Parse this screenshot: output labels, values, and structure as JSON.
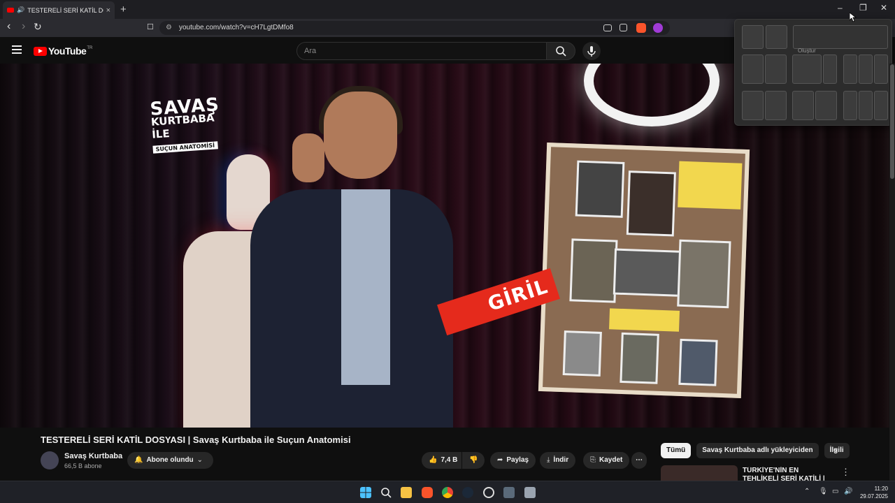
{
  "browser": {
    "tab_title": "TESTERELİ SERİ KATİL DOSYASI",
    "url": "youtube.com/watch?v=cH7LgtDMfo8",
    "new_tab": "+",
    "tab_close": "×",
    "minimize": "–",
    "restore": "❐",
    "close": "✕",
    "back": "‹",
    "forward": "›",
    "reload": "↻",
    "bookmark": "🔖"
  },
  "snap_menu": {
    "create_label": "Oluştur"
  },
  "youtube": {
    "logo_text": "YouTube",
    "country_code": "TR",
    "search_placeholder": "Ara"
  },
  "video": {
    "overlay_logo_line1": "SAVAŞ",
    "overlay_logo_line2": "KURTBABA İLE",
    "overlay_logo_line3": "SUÇUN ANATOMİSİ",
    "tape_text": "GİRİL"
  },
  "watch": {
    "title": "TESTERELİ SERİ KATİL DOSYASI | Savaş Kurtbaba ile Suçun Anatomisi",
    "channel_name": "Savaş Kurtbaba",
    "subscribers": "66,5 B abone",
    "subscribe_label": "Abone olundu",
    "likes": "7,4 B",
    "share_label": "Paylaş",
    "download_label": "İndir",
    "save_label": "Kaydet",
    "more_label": "⋯"
  },
  "related": {
    "chips": [
      "Tümü",
      "Savaş Kurtbaba adlı yükleyiciden",
      "İlgili"
    ],
    "next_arrow": "›",
    "rec_title": "TÜRKİYE'NİN EN TEHLİKELİ SERİ KATİLİ | Savaş Kurtbaba i"
  },
  "taskbar": {
    "time": "11:20",
    "date": "29.07.2025"
  },
  "colors": {
    "yt_red": "#ff0000",
    "bg": "#0f0f0f",
    "chrome": "#2b2b30"
  }
}
